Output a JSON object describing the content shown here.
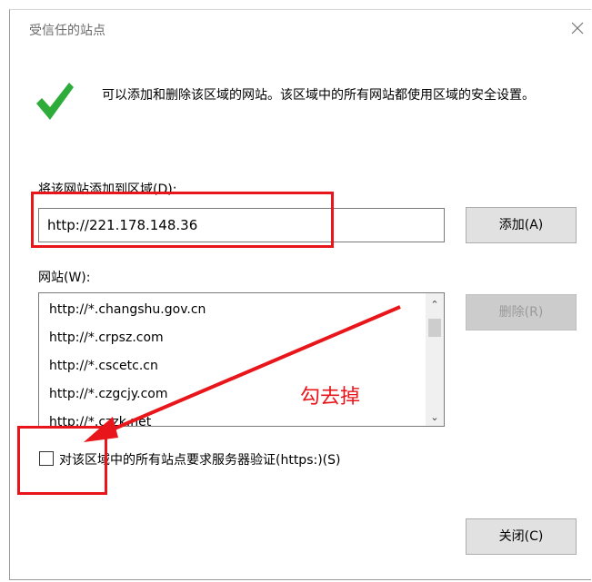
{
  "window": {
    "title": "受信任的站点",
    "close_icon": "close-icon"
  },
  "message": {
    "icon": "checkmark-icon",
    "text": "可以添加和删除该区域的网站。该区域中的所有网站都使用区域的安全设置。"
  },
  "add_section": {
    "label": "将该网站添加到区域(D):",
    "input_value": "http://221.178.148.36",
    "add_button": "添加(A)"
  },
  "sites_section": {
    "label": "网站(W):",
    "items": [
      "http://*.changshu.gov.cn",
      "http://*.crpsz.com",
      "http://*.cscetc.cn",
      "http://*.czgcjy.com",
      "http://*.czzk.net"
    ],
    "remove_button": "删除(R)"
  },
  "https_option": {
    "checked": false,
    "label": "对该区域中的所有站点要求服务器验证(https:)(S)"
  },
  "footer": {
    "close_button": "关闭(C)"
  },
  "annotation": {
    "text": "勾去掉",
    "color": "#e8161b"
  }
}
